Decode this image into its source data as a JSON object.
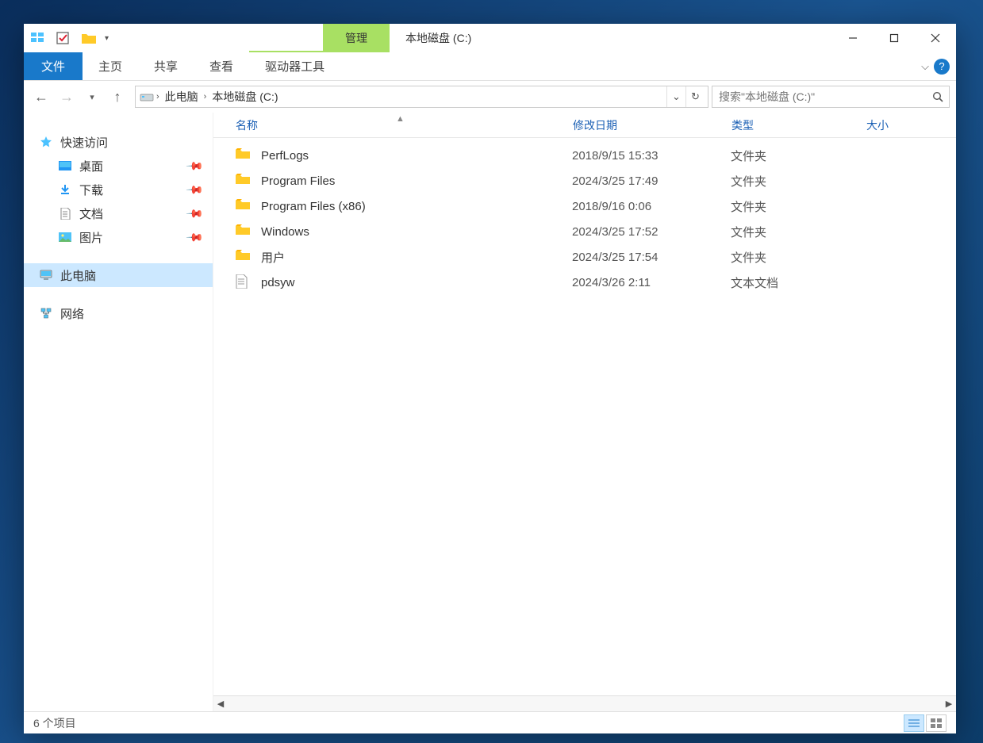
{
  "titlebar": {
    "manage_tab": "管理",
    "drive_tools_tab": "驱动器工具",
    "title": "本地磁盘 (C:)"
  },
  "ribbon": {
    "file": "文件",
    "home": "主页",
    "share": "共享",
    "view": "查看"
  },
  "nav": {
    "crumb1": "此电脑",
    "crumb2": "本地磁盘 (C:)",
    "search_placeholder": "搜索\"本地磁盘 (C:)\""
  },
  "sidebar": {
    "quick_access": "快速访问",
    "desktop": "桌面",
    "downloads": "下载",
    "documents": "文档",
    "pictures": "图片",
    "this_pc": "此电脑",
    "network": "网络"
  },
  "columns": {
    "name": "名称",
    "date": "修改日期",
    "type": "类型",
    "size": "大小"
  },
  "files": [
    {
      "name": "PerfLogs",
      "date": "2018/9/15 15:33",
      "type": "文件夹",
      "icon": "folder"
    },
    {
      "name": "Program Files",
      "date": "2024/3/25 17:49",
      "type": "文件夹",
      "icon": "folder"
    },
    {
      "name": "Program Files (x86)",
      "date": "2018/9/16 0:06",
      "type": "文件夹",
      "icon": "folder"
    },
    {
      "name": "Windows",
      "date": "2024/3/25 17:52",
      "type": "文件夹",
      "icon": "folder"
    },
    {
      "name": "用户",
      "date": "2024/3/25 17:54",
      "type": "文件夹",
      "icon": "folder"
    },
    {
      "name": "pdsyw",
      "date": "2024/3/26 2:11",
      "type": "文本文档",
      "icon": "text"
    }
  ],
  "status": {
    "item_count": "6 个项目"
  }
}
